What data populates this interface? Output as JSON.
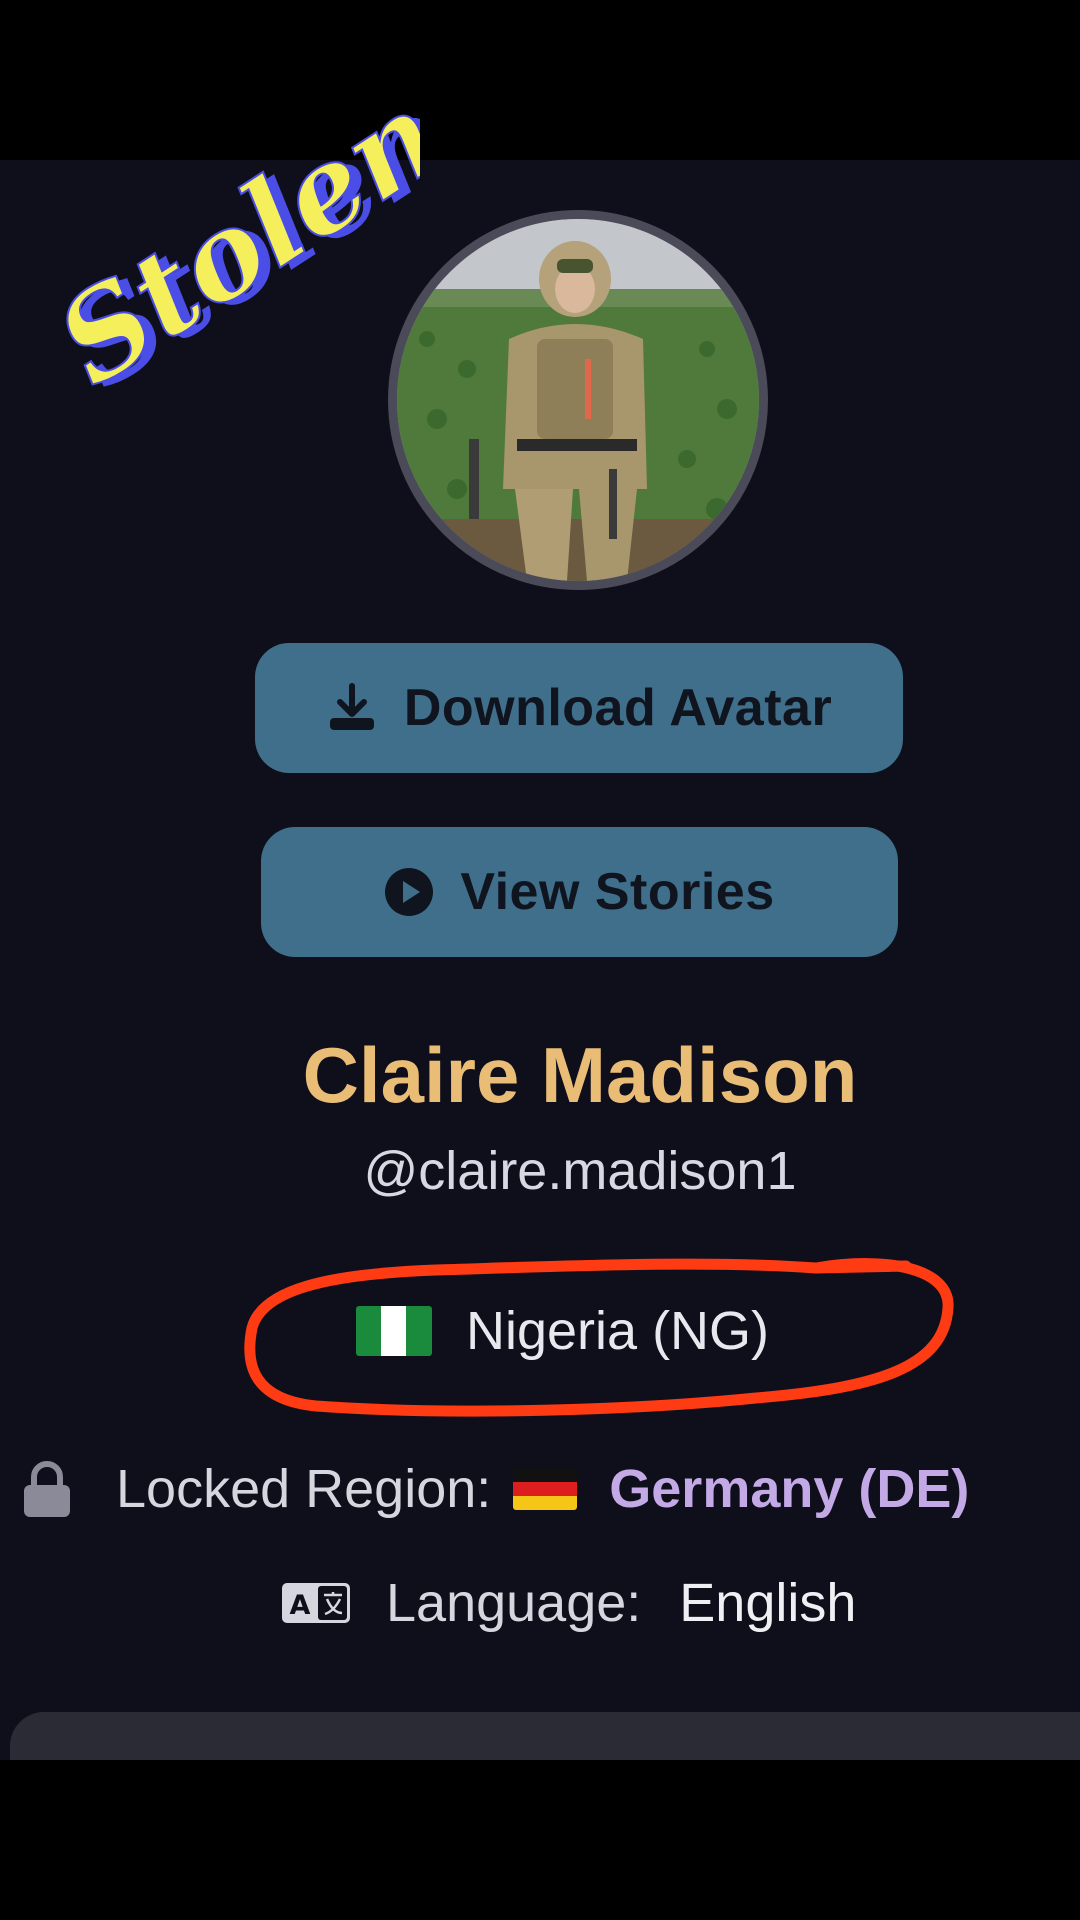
{
  "watermark": {
    "text": "Stolen"
  },
  "profile": {
    "avatar_icon": "avatar-photo",
    "display_name": "Claire Madison",
    "username": "@claire.madison1"
  },
  "actions": {
    "download_label": "Download Avatar",
    "download_icon": "download-icon",
    "stories_label": "View Stories",
    "stories_icon": "play-circle-icon"
  },
  "country": {
    "flag_icon": "nigeria-flag-icon",
    "label": "Nigeria (NG)"
  },
  "locked_region": {
    "icon": "lock-icon",
    "label": "Locked Region:",
    "flag_icon": "germany-flag-icon",
    "value": "Germany (DE)"
  },
  "language": {
    "icon": "translate-icon",
    "label": "Language:",
    "value": "English"
  },
  "colors": {
    "background": "#0f0f1c",
    "button": "#3f6f8a",
    "name": "#e9bd76",
    "locked_value": "#c3a9e6",
    "annotation_circle": "#ff3b14",
    "watermark_fill": "#f5ef5c",
    "watermark_shadow": "#4a4ee6"
  }
}
